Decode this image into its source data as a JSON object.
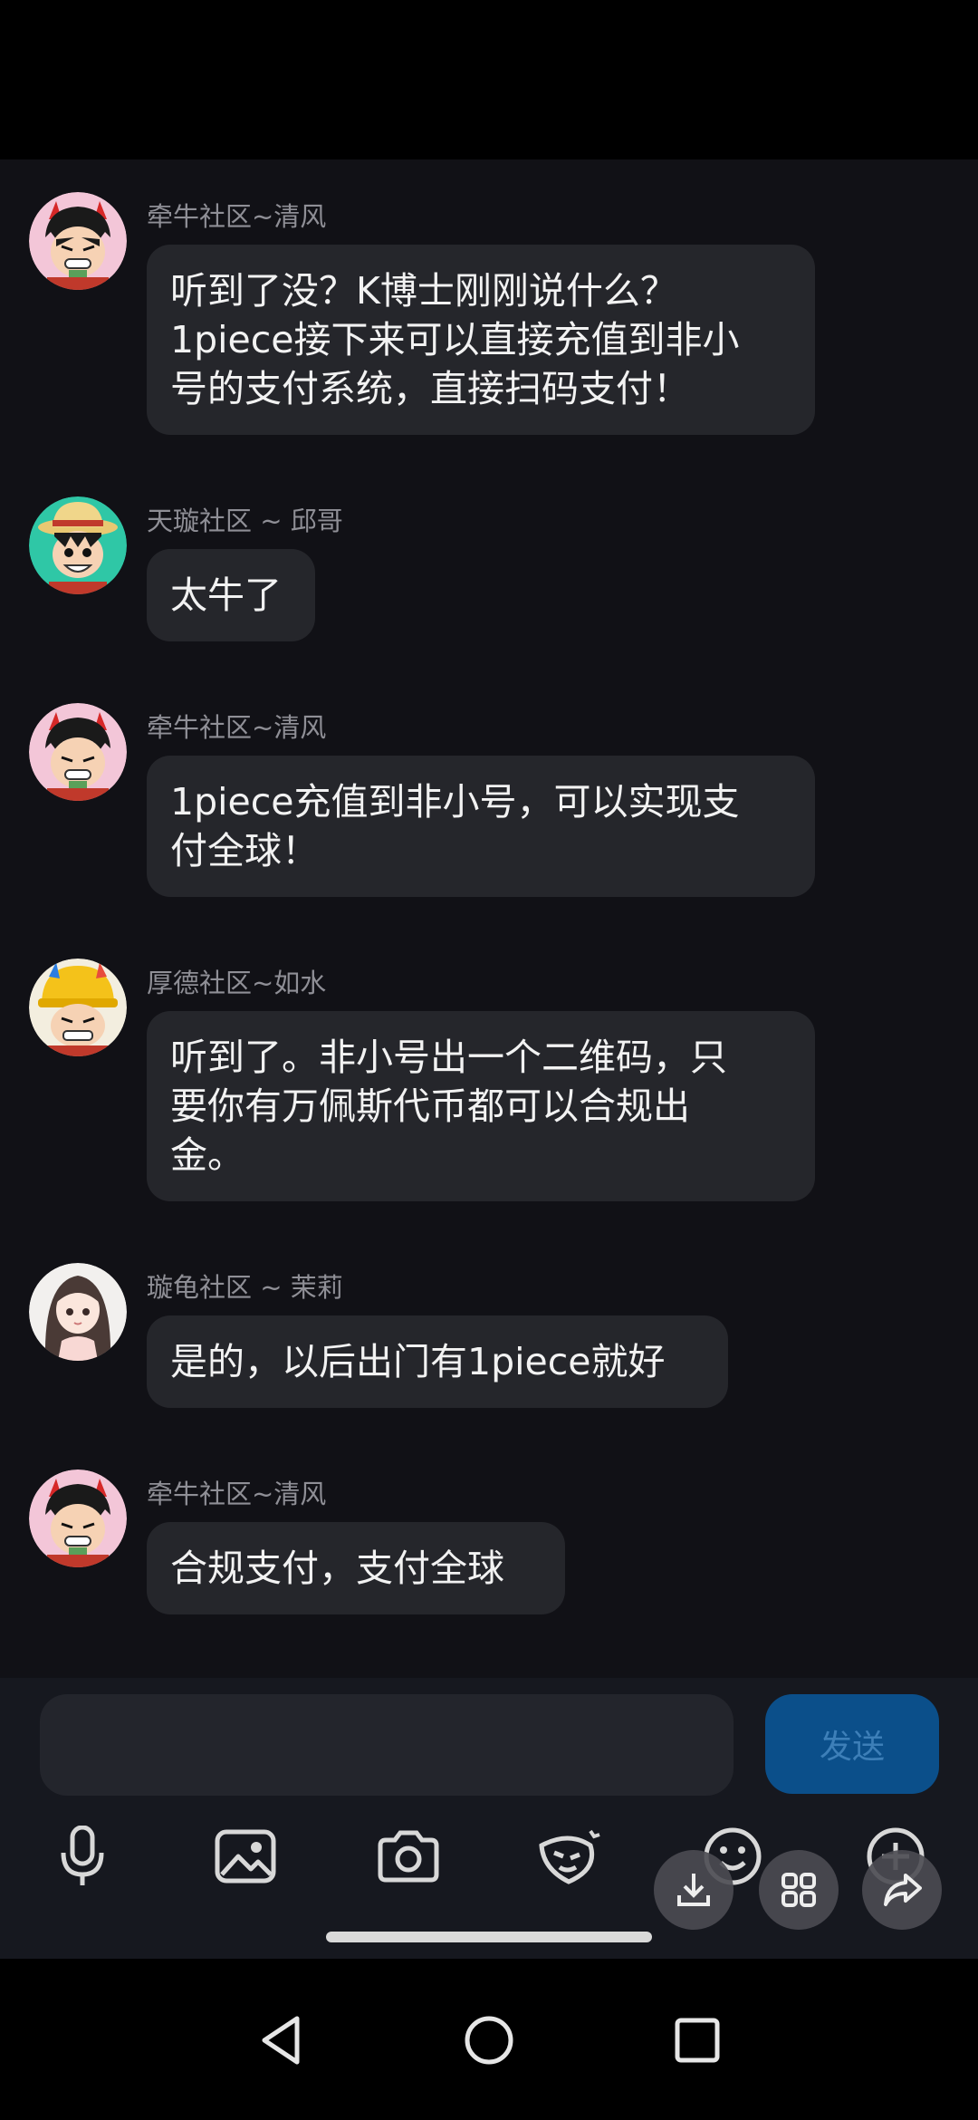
{
  "messages": [
    {
      "sender": "牵牛社区~清风",
      "avatar": "luffy-devil-avatar",
      "lines": [
        "听到了没？K博士刚刚说什么？",
        "1piece接下来可以直接充值到非小",
        "号的支付系统，直接扫码支付！"
      ]
    },
    {
      "sender": "天璇社区 ~ 邱哥",
      "avatar": "luffy-hat-avatar",
      "lines": [
        "太牛了"
      ]
    },
    {
      "sender": "牵牛社区~清风",
      "avatar": "luffy-devil-avatar",
      "lines": [
        "1piece充值到非小号，可以实现支",
        "付全球！"
      ]
    },
    {
      "sender": "厚德社区~如水",
      "avatar": "helmet-avatar",
      "lines": [
        "听到了。非小号出一个二维码，只",
        "要你有万佩斯代币都可以合规出",
        "金。"
      ]
    },
    {
      "sender": "璇龟社区 ~ 茉莉",
      "avatar": "girl-avatar",
      "lines": [
        "是的，以后出门有1piece就好"
      ]
    },
    {
      "sender": "牵牛社区~清风",
      "avatar": "luffy-devil-avatar",
      "lines": [
        "合规支付，支付全球"
      ]
    }
  ],
  "input": {
    "value": "",
    "send_label": "发送"
  },
  "toolbar": [
    "microphone-icon",
    "image-icon",
    "camera-icon",
    "sticker-icon",
    "emoji-icon",
    "add-icon"
  ],
  "floating_actions": [
    "download-icon",
    "grid-icon",
    "share-icon"
  ],
  "nav": [
    "back-icon",
    "home-icon",
    "recents-icon"
  ]
}
